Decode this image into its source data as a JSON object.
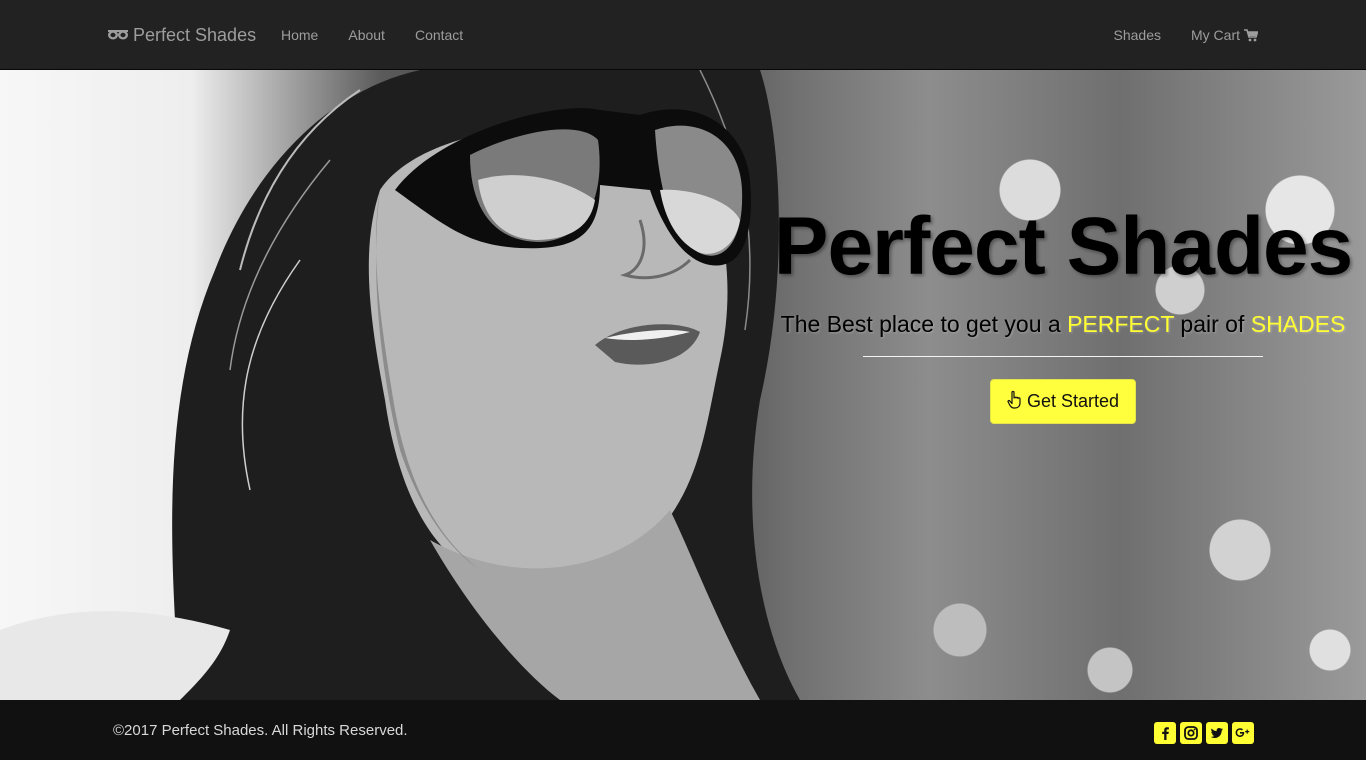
{
  "navbar": {
    "brand_label": "Perfect Shades",
    "brand_icon": "sunglasses-icon",
    "left_links": [
      "Home",
      "About",
      "Contact"
    ],
    "right_links": {
      "shades": "Shades",
      "cart": "My Cart",
      "cart_icon": "shopping-cart-icon"
    }
  },
  "hero": {
    "title": "Perfect Shades",
    "tagline": {
      "part1": "The Best place to get you a ",
      "highlight1": "PERFECT",
      "part2": " pair of ",
      "highlight2": "SHADES"
    },
    "cta_label": "Get Started",
    "cta_icon": "hand-pointer-icon"
  },
  "footer": {
    "copyright": "©2017 Perfect Shades. All Rights Reserved.",
    "social_icons": [
      "facebook-icon",
      "instagram-icon",
      "twitter-icon",
      "google-plus-icon"
    ]
  },
  "colors": {
    "navbar_bg": "#222222",
    "nav_text": "#9d9d9d",
    "accent": "#ffff33",
    "footer_bg": "#111111"
  }
}
